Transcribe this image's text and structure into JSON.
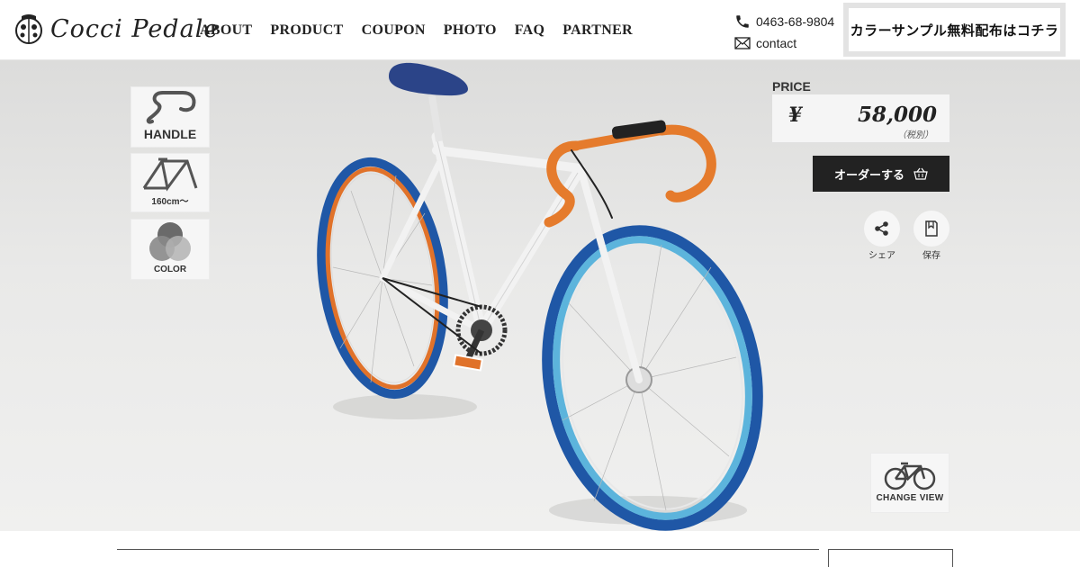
{
  "header": {
    "logo_text": "Cocci Pedale",
    "nav": [
      "ABOUT",
      "PRODUCT",
      "COUPON",
      "PHOTO",
      "FAQ",
      "PARTNER"
    ],
    "phone": "0463-68-9804",
    "contact_label": "contact",
    "cta_label": "カラーサンプル無料配布はコチラ"
  },
  "options": {
    "handle_label": "HANDLE",
    "frame_label": "160cm〜",
    "color_label": "COLOR"
  },
  "price": {
    "label": "PRICE",
    "currency": "¥",
    "value": "58,000",
    "tax_note": "（税別）"
  },
  "actions": {
    "order_label": "オーダーする",
    "share_label": "シェア",
    "save_label": "保存",
    "change_view_label": "CHANGE VIEW"
  },
  "colors": {
    "saddle": "#2b4488",
    "tire": "#1f57a6",
    "rim_front": "#5cb4dc",
    "rim_rear": "#e0722a",
    "handlebar_tape": "#e57b2c",
    "frame": "#f2f2f2"
  }
}
